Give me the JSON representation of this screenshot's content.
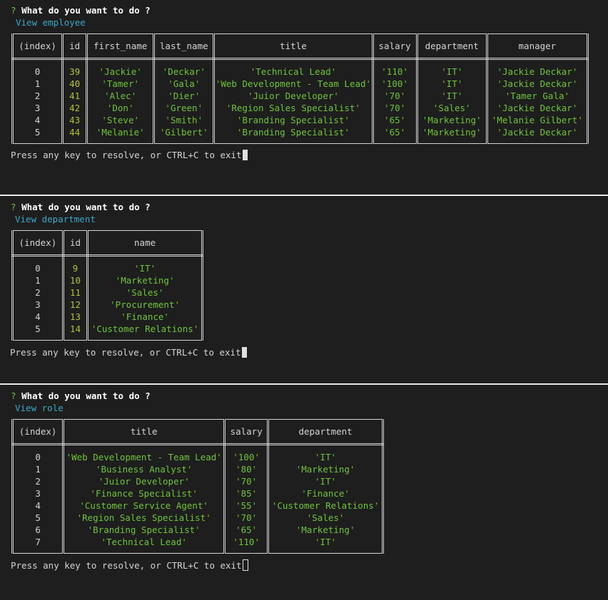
{
  "common": {
    "question_mark": "?",
    "question": "What do you want to do ?",
    "press_prompt": "Press any key to resolve, or CTRL+C to exit"
  },
  "employee": {
    "answer": "View employee",
    "columns": [
      "(index)",
      "id",
      "first_name",
      "last_name",
      "title",
      "salary",
      "department",
      "manager"
    ],
    "rows": [
      [
        "0",
        "39",
        "'Jackie'",
        "'Deckar'",
        "'Technical Lead'",
        "'110'",
        "'IT'",
        "'Jackie Deckar'"
      ],
      [
        "1",
        "40",
        "'Tamer'",
        "'Gala'",
        "'Web Development - Team Lead'",
        "'100'",
        "'IT'",
        "'Jackie Deckar'"
      ],
      [
        "2",
        "41",
        "'Alec'",
        "'Dier'",
        "'Juior Developer'",
        "'70'",
        "'IT'",
        "'Tamer Gala'"
      ],
      [
        "3",
        "42",
        "'Don'",
        "'Green'",
        "'Region Sales Specialist'",
        "'70'",
        "'Sales'",
        "'Jackie Deckar'"
      ],
      [
        "4",
        "43",
        "'Steve'",
        "'Smith'",
        "'Branding Specialist'",
        "'65'",
        "'Marketing'",
        "'Melanie Gilbert'"
      ],
      [
        "5",
        "44",
        "'Melanie'",
        "'Gilbert'",
        "'Branding Specialist'",
        "'65'",
        "'Marketing'",
        "'Jackie Deckar'"
      ]
    ]
  },
  "department": {
    "answer": "View department",
    "columns": [
      "(index)",
      "id",
      "name"
    ],
    "rows": [
      [
        "0",
        "9",
        "'IT'"
      ],
      [
        "1",
        "10",
        "'Marketing'"
      ],
      [
        "2",
        "11",
        "'Sales'"
      ],
      [
        "3",
        "12",
        "'Procurement'"
      ],
      [
        "4",
        "13",
        "'Finance'"
      ],
      [
        "5",
        "14",
        "'Customer Relations'"
      ]
    ]
  },
  "role": {
    "answer": "View role",
    "columns": [
      "(index)",
      "title",
      "salary",
      "department"
    ],
    "rows": [
      [
        "0",
        "'Web Development - Team Lead'",
        "'100'",
        "'IT'"
      ],
      [
        "1",
        "'Business Analyst'",
        "'80'",
        "'Marketing'"
      ],
      [
        "2",
        "'Juior Developer'",
        "'70'",
        "'IT'"
      ],
      [
        "3",
        "'Finance Specialist'",
        "'85'",
        "'Finance'"
      ],
      [
        "4",
        "'Customer Service Agent'",
        "'55'",
        "'Customer Relations'"
      ],
      [
        "5",
        "'Region Sales Specialist'",
        "'70'",
        "'Sales'"
      ],
      [
        "6",
        "'Branding Specialist'",
        "'65'",
        "'Marketing'"
      ],
      [
        "7",
        "'Technical Lead'",
        "'110'",
        "'IT'"
      ]
    ]
  }
}
